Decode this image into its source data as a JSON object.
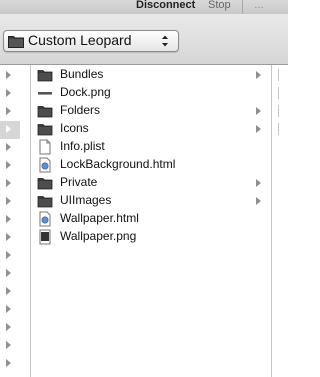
{
  "toolbar": {
    "disconnect_label": "Disconnect",
    "stop_label": "Stop",
    "more_label": "…"
  },
  "path": {
    "current_folder": "Custom Leopard"
  },
  "files": [
    {
      "name": "Bundles",
      "kind": "folder",
      "has_children": true
    },
    {
      "name": "Dock.png",
      "kind": "image-strip",
      "has_children": false
    },
    {
      "name": "Folders",
      "kind": "folder",
      "has_children": true
    },
    {
      "name": "Icons",
      "kind": "folder",
      "has_children": true
    },
    {
      "name": "Info.plist",
      "kind": "document",
      "has_children": false
    },
    {
      "name": "LockBackground.html",
      "kind": "html",
      "has_children": false
    },
    {
      "name": "Private",
      "kind": "folder",
      "has_children": true
    },
    {
      "name": "UIImages",
      "kind": "folder",
      "has_children": true
    },
    {
      "name": "Wallpaper.html",
      "kind": "html",
      "has_children": false
    },
    {
      "name": "Wallpaper.png",
      "kind": "image",
      "has_children": false
    }
  ],
  "colors": {
    "folder": "#4a4a4a",
    "arrow": "#8f8f8f",
    "selection": "#d6d6d6"
  }
}
